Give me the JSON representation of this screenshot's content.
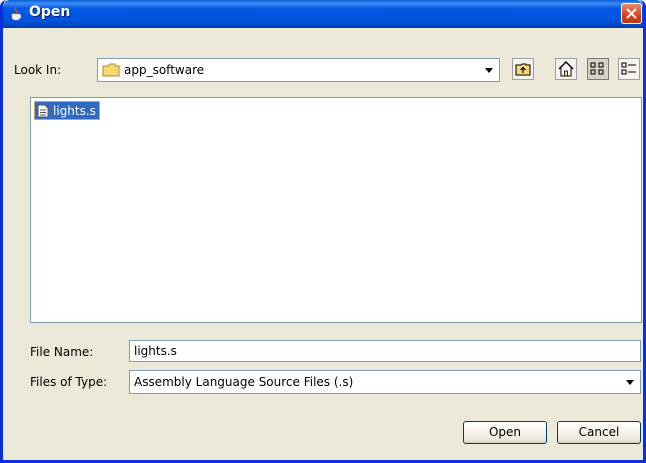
{
  "window": {
    "title": "Open"
  },
  "toolbar": {
    "look_in_label": "Look In:",
    "look_in_value": "app_software"
  },
  "files": [
    {
      "name": "lights.s",
      "selected": true
    }
  ],
  "form": {
    "file_name_label": "File Name:",
    "file_name_value": "lights.s",
    "file_type_label": "Files of Type:",
    "file_type_value": "Assembly Language Source Files (.s)"
  },
  "buttons": {
    "open": "Open",
    "cancel": "Cancel"
  },
  "colors": {
    "titlebar": "#0055e0",
    "selection": "#316ac5",
    "dialog_bg": "#ece9d8",
    "close": "#d4421e"
  },
  "icons": [
    "java-cup-icon",
    "close-icon",
    "folder-icon",
    "up-folder-icon",
    "home-icon",
    "list-view-icon",
    "details-view-icon",
    "file-icon",
    "dropdown-arrow-icon"
  ]
}
